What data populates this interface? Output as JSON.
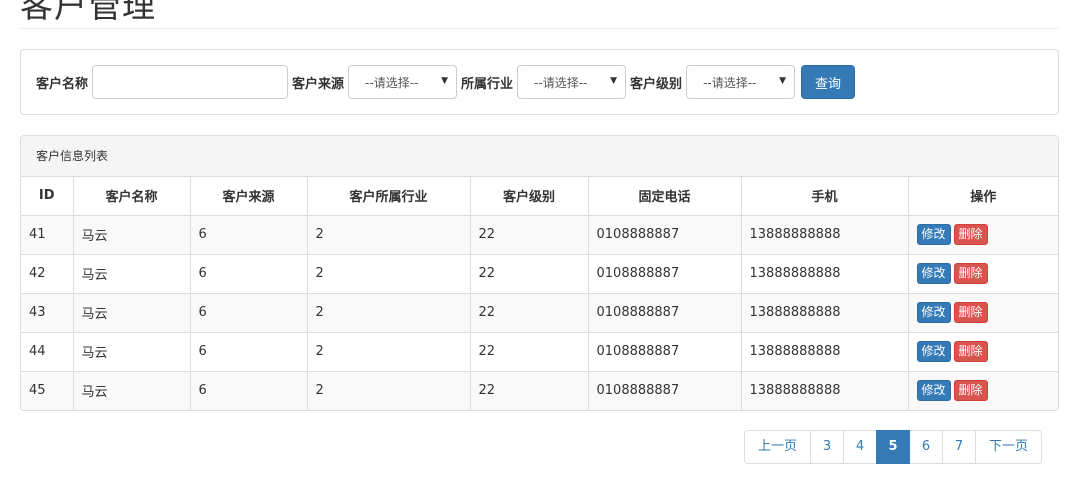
{
  "page": {
    "title": "客户管理"
  },
  "search": {
    "name_label": "客户名称",
    "name_value": "",
    "source_label": "客户来源",
    "source_selected": "--请选择--",
    "industry_label": "所属行业",
    "industry_selected": "--请选择--",
    "level_label": "客户级别",
    "level_selected": "--请选择--",
    "query_label": "查询"
  },
  "list": {
    "heading": "客户信息列表",
    "columns": [
      "ID",
      "客户名称",
      "客户来源",
      "客户所属行业",
      "客户级别",
      "固定电话",
      "手机",
      "操作"
    ],
    "edit_label": "修改",
    "delete_label": "删除",
    "rows": [
      {
        "id": "41",
        "name": "马云",
        "source": "6",
        "industry": "2",
        "level": "22",
        "phone": "0108888887",
        "mobile": "13888888888"
      },
      {
        "id": "42",
        "name": "马云",
        "source": "6",
        "industry": "2",
        "level": "22",
        "phone": "0108888887",
        "mobile": "13888888888"
      },
      {
        "id": "43",
        "name": "马云",
        "source": "6",
        "industry": "2",
        "level": "22",
        "phone": "0108888887",
        "mobile": "13888888888"
      },
      {
        "id": "44",
        "name": "马云",
        "source": "6",
        "industry": "2",
        "level": "22",
        "phone": "0108888887",
        "mobile": "13888888888"
      },
      {
        "id": "45",
        "name": "马云",
        "source": "6",
        "industry": "2",
        "level": "22",
        "phone": "0108888887",
        "mobile": "13888888888"
      }
    ]
  },
  "pagination": {
    "prev_label": "上一页",
    "pages": [
      "3",
      "4",
      "5",
      "6",
      "7"
    ],
    "active_page": "5",
    "next_label": "下一页"
  },
  "colors": {
    "primary": "#337ab7",
    "danger": "#d9534f",
    "border": "#dddddd"
  },
  "icons": {
    "select_caret": "caret-down-icon"
  }
}
